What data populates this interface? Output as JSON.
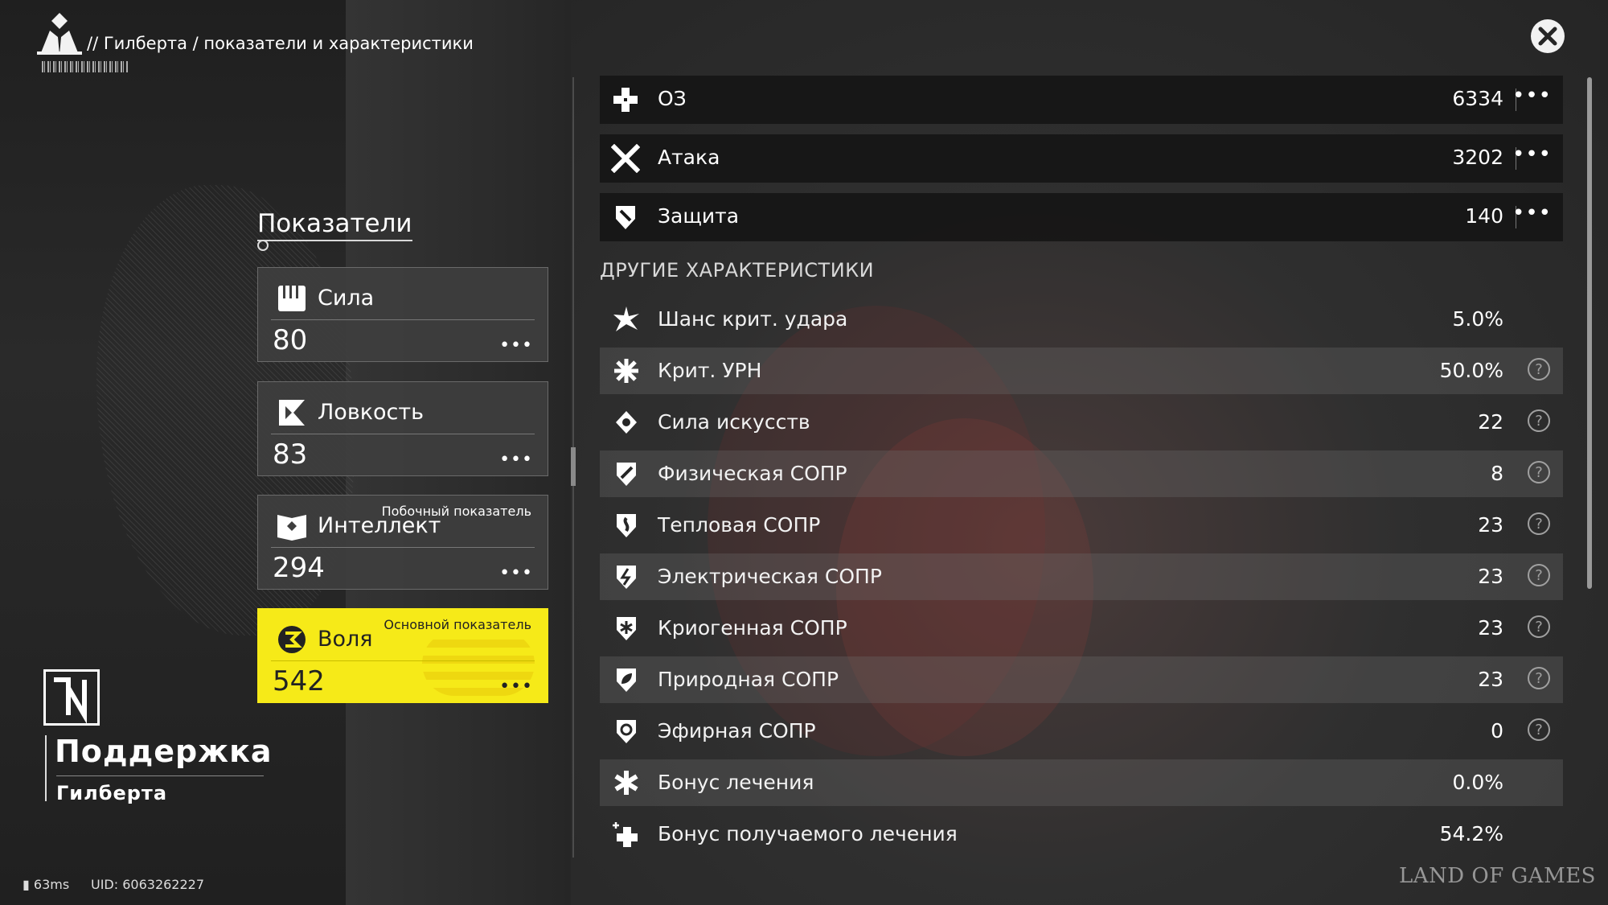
{
  "header": {
    "breadcrumb": "// Гилберта / показатели и характеристики"
  },
  "left": {
    "section_title": "Показатели",
    "stats": [
      {
        "icon": "fist-icon",
        "name": "Сила",
        "value": "80",
        "tag": ""
      },
      {
        "icon": "agility-icon",
        "name": "Ловкость",
        "value": "83",
        "tag": ""
      },
      {
        "icon": "book-icon",
        "name": "Интеллект",
        "value": "294",
        "tag": "Побочный показатель"
      },
      {
        "icon": "will-icon",
        "name": "Воля",
        "value": "542",
        "tag": "Основной показатель"
      }
    ],
    "dots": "•••",
    "role_title": "Поддержка",
    "role_name": "Гилберта"
  },
  "footer": {
    "ping": "63ms",
    "uid": "UID: 6063262227",
    "watermark": "LAND OF GAMES"
  },
  "main_stats": [
    {
      "icon": "hp-cross-icon",
      "name": "ОЗ",
      "value": "6334"
    },
    {
      "icon": "swords-icon",
      "name": "Атака",
      "value": "3202"
    },
    {
      "icon": "shield-icon",
      "name": "Защита",
      "value": "140"
    }
  ],
  "other_title": "ДРУГИЕ ХАРАКТЕРИСТИКИ",
  "other_stats": [
    {
      "icon": "crit-burst-icon",
      "name": "Шанс крит. удара",
      "value": "5.0%",
      "help": false
    },
    {
      "icon": "crit-damage-icon",
      "name": "Крит. УРН",
      "value": "50.0%",
      "help": true
    },
    {
      "icon": "arts-icon",
      "name": "Сила искусств",
      "value": "22",
      "help": true
    },
    {
      "icon": "physical-res-icon",
      "name": "Физическая СОПР",
      "value": "8",
      "help": true
    },
    {
      "icon": "heat-res-icon",
      "name": "Тепловая СОПР",
      "value": "23",
      "help": true
    },
    {
      "icon": "electric-res-icon",
      "name": "Электрическая СОПР",
      "value": "23",
      "help": true
    },
    {
      "icon": "cryo-res-icon",
      "name": "Криогенная СОПР",
      "value": "23",
      "help": true
    },
    {
      "icon": "nature-res-icon",
      "name": "Природная СОПР",
      "value": "23",
      "help": true
    },
    {
      "icon": "ether-res-icon",
      "name": "Эфирная СОПР",
      "value": "0",
      "help": true
    },
    {
      "icon": "heal-bonus-icon",
      "name": "Бонус лечения",
      "value": "0.0%",
      "help": false
    },
    {
      "icon": "received-heal-icon",
      "name": "Бонус получаемого лечения",
      "value": "54.2%",
      "help": false
    }
  ],
  "help_glyph": "?",
  "colors": {
    "accent_yellow": "#f6ea18",
    "background": "#262626"
  }
}
